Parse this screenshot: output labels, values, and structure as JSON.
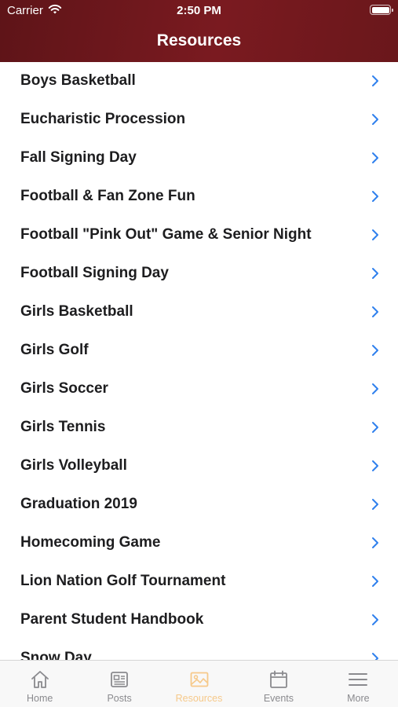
{
  "status_bar": {
    "carrier": "Carrier",
    "time": "2:50 PM"
  },
  "nav": {
    "title": "Resources"
  },
  "resources": [
    {
      "label": "Boys Basketball"
    },
    {
      "label": "Eucharistic Procession"
    },
    {
      "label": "Fall Signing Day"
    },
    {
      "label": "Football & Fan Zone Fun"
    },
    {
      "label": "Football \"Pink Out\" Game & Senior Night"
    },
    {
      "label": "Football Signing Day"
    },
    {
      "label": "Girls Basketball"
    },
    {
      "label": "Girls Golf"
    },
    {
      "label": "Girls Soccer"
    },
    {
      "label": "Girls Tennis"
    },
    {
      "label": "Girls Volleyball"
    },
    {
      "label": "Graduation 2019"
    },
    {
      "label": "Homecoming Game"
    },
    {
      "label": "Lion Nation Golf Tournament"
    },
    {
      "label": "Parent Student Handbook"
    },
    {
      "label": "Snow Day"
    }
  ],
  "tabs": [
    {
      "label": "Home",
      "icon": "home-icon",
      "active": false
    },
    {
      "label": "Posts",
      "icon": "posts-icon",
      "active": false
    },
    {
      "label": "Resources",
      "icon": "image-icon",
      "active": true
    },
    {
      "label": "Events",
      "icon": "calendar-icon",
      "active": false
    },
    {
      "label": "More",
      "icon": "menu-icon",
      "active": false
    }
  ],
  "colors": {
    "header": "#6e181d",
    "chevron": "#2f80ed",
    "active_tab": "#f6c98a",
    "inactive_tab": "#8a8a8e"
  }
}
